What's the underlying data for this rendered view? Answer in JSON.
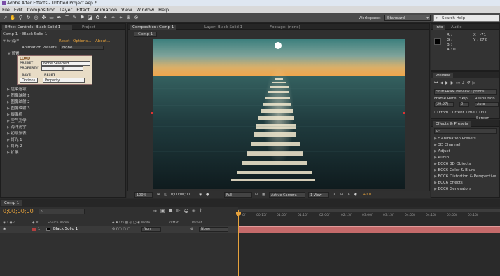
{
  "app": {
    "title": "Adobe After Effects - Untitled Project.aep *"
  },
  "menu": [
    "File",
    "Edit",
    "Composition",
    "Layer",
    "Effect",
    "Animation",
    "View",
    "Window",
    "Help"
  ],
  "toolbar": {
    "workspace_label": "Workspace:",
    "workspace_value": "Standard",
    "search_placeholder": "Search Help"
  },
  "effect_controls": {
    "tabs": [
      "Effect Controls: Black Solid 1",
      "Project"
    ],
    "breadcrumb": "Comp 1 • Black Solid 1",
    "effect": {
      "prefix": "fx",
      "name": "海洋",
      "reset": "Reset",
      "options": "Options...",
      "about": "About..."
    },
    "animation_presets_label": "Animation Presets:",
    "animation_presets_value": "None",
    "group_label": "预置",
    "preset_box": {
      "load": "LOAD",
      "preset_label": "PRESET",
      "preset_value": "None Selected",
      "property_label": "PROPERTY",
      "property_value": "全",
      "save": "SAVE",
      "options_btn": "Options...",
      "reset": "RESET",
      "property_btn": "Property"
    },
    "params": [
      "渲染选项",
      "图像映射 1",
      "图像映射 2",
      "图像映射 3",
      "摄像机",
      "空气光学",
      "海洋光学",
      "初级波表",
      "灯光 1",
      "灯光 2",
      "扩展"
    ]
  },
  "composition": {
    "tabs": [
      "Composition: Comp 1",
      "Layer: Black Solid 1",
      "Footage: (none)"
    ],
    "subtab": "Comp 1",
    "viewer_bar": {
      "zoom": "100%",
      "timecode": "0;00;00;00",
      "resolution": "Full",
      "camera": "Active Camera",
      "views": "1 View",
      "offset": "+0.0"
    }
  },
  "info": {
    "tabs": [
      "Info",
      "Audio"
    ],
    "r": "R :",
    "g": "G :",
    "b": "B :",
    "a": "A : 0",
    "x": "X : -71",
    "y": "Y : 272"
  },
  "preview": {
    "title": "Preview",
    "ram_option": "Shift+RAM Preview Options",
    "frame_rate_label": "Frame Rate",
    "skip_label": "Skip",
    "resolution_label": "Resolution",
    "frame_rate_value": "(29.97)",
    "skip_value": "0",
    "resolution_value": "Auto",
    "from_current": "From Current Time",
    "full_screen": "Full Screen"
  },
  "effects_presets": {
    "title": "Effects & Presets",
    "search_placeholder": "ρ-",
    "items": [
      "* Animation Presets",
      "3D Channel",
      "Adjust",
      "Audio",
      "BCC6 3D Objects",
      "BCC6 Color & Blurs",
      "BCC6 Distortion & Perspective",
      "BCC6 Effects",
      "BCC6 Generators"
    ]
  },
  "timeline": {
    "tab": "Comp 1",
    "timecode": "0;00;00;00",
    "columns": {
      "source": "Source Name",
      "mode": "Mode",
      "trkmat": "TrkMat",
      "parent": "Parent"
    },
    "layer": {
      "index": "1",
      "name": "Black Solid 1",
      "mode": "Norr",
      "parent": "None"
    },
    "ruler": [
      "0f",
      "00:15f",
      "01:00f",
      "01:15f",
      "02:00f",
      "02:15f",
      "03:00f",
      "03:15f",
      "04:00f",
      "04:15f",
      "05:00f",
      "05:15f"
    ]
  },
  "colors": {
    "accent": "#e6a23c",
    "layer_bar": "#c46a6a",
    "label_red": "#b34040"
  }
}
